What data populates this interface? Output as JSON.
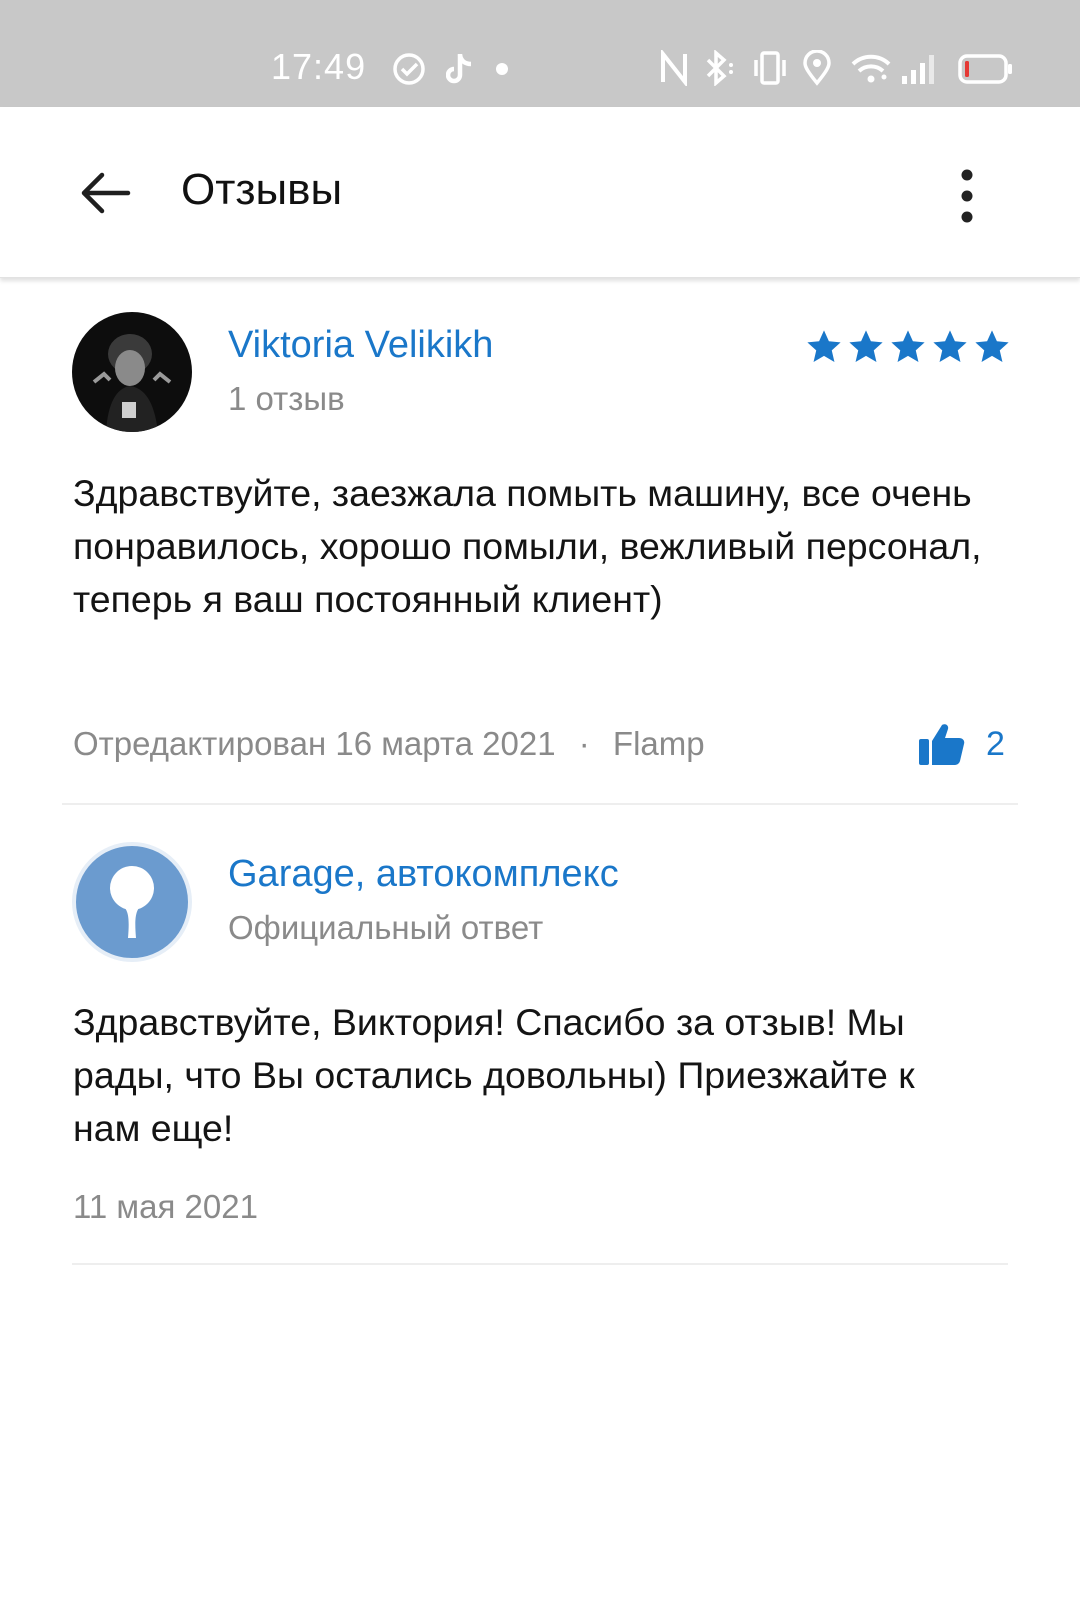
{
  "status_bar": {
    "time": "17:49",
    "left_icons": [
      "check-circle-icon",
      "tiktok-icon",
      "dot-icon"
    ],
    "right_icons": [
      "nfc-icon",
      "bluetooth-icon",
      "vibrate-icon",
      "location-icon",
      "wifi-icon",
      "signal-icon",
      "battery-icon"
    ],
    "battery_color": "#e53935"
  },
  "app_bar": {
    "back_icon": "arrow-left-icon",
    "title": "Отзывы",
    "menu_icon": "more-vert-icon"
  },
  "review": {
    "author": "Viktoria Velikikh",
    "author_reviews": "1 отзыв",
    "rating": 5,
    "rating_max": 5,
    "text": "Здравствуйте, заезжала помыть машину, все очень понравилось, хорошо помыли, вежливый персонал, теперь я ваш постоянный клиент)",
    "edited": "Отредактирован 16 марта 2021",
    "separator": "·",
    "source": "Flamp",
    "likes": "2",
    "like_icon": "thumbs-up-icon"
  },
  "reply": {
    "author": "Garage, автокомплекс",
    "label": "Официальный ответ",
    "text": "Здравствуйте, Виктория! Спасибо за отзыв! Мы рады, что Вы остались довольны) Приезжайте к нам еще!",
    "date": "11 мая 2021",
    "avatar_icon": "map-pin-icon"
  },
  "colors": {
    "accent": "#1a77c9",
    "star": "#1a77c9",
    "secondary_text": "#8a8a8a",
    "reply_avatar_bg": "#6b9bcf",
    "status_bar_bg": "#c8c8c8"
  }
}
